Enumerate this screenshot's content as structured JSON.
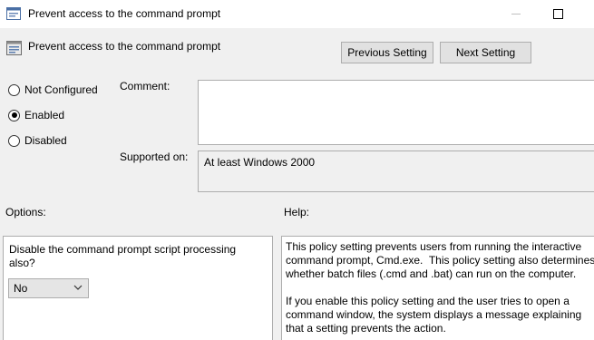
{
  "window": {
    "title": "Prevent access to the command prompt",
    "app_icon": "policy-settings-icon",
    "minimize_icon": "minimize-icon",
    "maximize_icon": "maximize-icon"
  },
  "header": {
    "title": "Prevent access to the command prompt",
    "icon": "policy-setting-icon",
    "previous_label": "Previous Setting",
    "next_label": "Next Setting"
  },
  "state": {
    "options": [
      {
        "label": "Not Configured",
        "checked": false
      },
      {
        "label": "Enabled",
        "checked": true
      },
      {
        "label": "Disabled",
        "checked": false
      }
    ]
  },
  "comment": {
    "label": "Comment:",
    "value": ""
  },
  "supported": {
    "label": "Supported on:",
    "value": "At least Windows 2000"
  },
  "options_section": {
    "label": "Options:",
    "question": "Disable the command prompt script processing also?",
    "select_value": "No"
  },
  "help_section": {
    "label": "Help:",
    "paragraph1": "This policy setting prevents users from running the interactive\ncommand prompt, Cmd.exe.  This policy setting also determines\nwhether batch files (.cmd and .bat) can run on the computer.",
    "paragraph2": "If you enable this policy setting and the user tries to open a\ncommand window, the system displays a message explaining\nthat a setting prevents the action."
  },
  "colors": {
    "window_bg": "#f0f0f0",
    "button_bg": "#e1e1e1",
    "border": "#adadad"
  }
}
